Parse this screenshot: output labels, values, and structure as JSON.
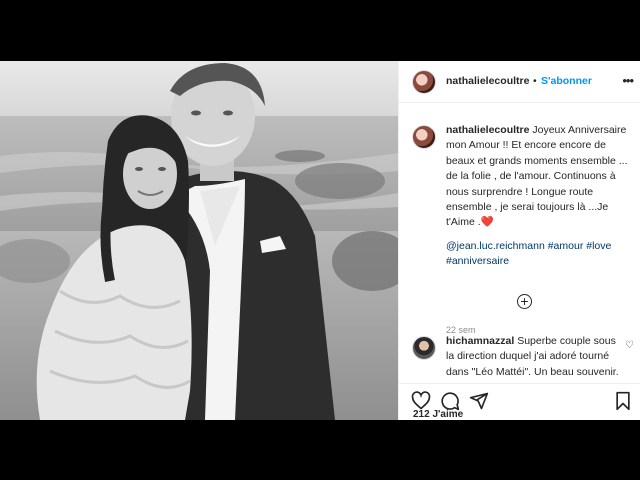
{
  "post": {
    "author": {
      "username": "nathalielecoultre",
      "separator": "•",
      "follow_label": "S'abonner"
    },
    "caption": {
      "username": "nathalielecoultre",
      "text": "Joyeux Anniversaire mon Amour !! Et encore encore de beaux et grands moments ensemble ... de la folie , de l'amour. Continuons à nous surprendre ! Longue route ensemble , je serai toujours là ...Je t'Aime .",
      "heart_emoji": "❤️",
      "tags": "@jean.luc.reichmann #amour #love #anniversaire",
      "time": "22 sem"
    },
    "load_more_label": "+",
    "comment": {
      "username": "hichamnazzal",
      "text": "Superbe couple sous la direction duquel j'ai adoré tourné dans \"Léo Mattéi\". Un beau souvenir. Bises"
    },
    "likes_text": "212 J'aime"
  },
  "icons": {
    "more": "more-options-icon",
    "like": "heart-icon",
    "comment": "comment-icon",
    "share": "share-icon",
    "save": "bookmark-icon",
    "comment_like": "small-heart-icon"
  },
  "colors": {
    "follow": "#0095f6",
    "tag": "#00376b",
    "time": "#8e8e8e",
    "text": "#262626",
    "heart": "#ed4956"
  }
}
